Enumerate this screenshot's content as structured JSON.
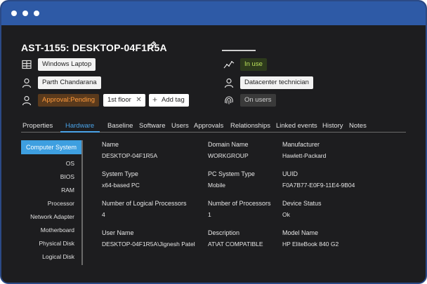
{
  "asset": {
    "title": "AST-1155: DESKTOP-04F1R5A"
  },
  "properties": {
    "type": "Windows Laptop",
    "user": "Parth Chandarana",
    "approval": "Approval:Pending",
    "tag": "1st floor",
    "add_tag": "Add tag",
    "state": "In use",
    "department": "Datacenter technician",
    "site": "On users"
  },
  "tabs": [
    "Properties",
    "Hardware",
    "Baseline",
    "Software",
    "Users",
    "Approvals",
    "Relationships",
    "Linked events",
    "History",
    "Notes"
  ],
  "active_tab": "Hardware",
  "sidebar": {
    "items": [
      "Computer System",
      "OS",
      "BIOS",
      "RAM",
      "Processor",
      "Network Adapter",
      "Motherboard",
      "Physical Disk",
      "Logical Disk"
    ]
  },
  "fields": [
    {
      "label": "Name",
      "value": "DESKTOP-04F1R5A"
    },
    {
      "label": "Domain Name",
      "value": "WORKGROUP"
    },
    {
      "label": "Manufacturer",
      "value": "Hawlett-Packard"
    },
    {
      "label": "System Type",
      "value": "x64-based PC"
    },
    {
      "label": "PC System Type",
      "value": "Mobile"
    },
    {
      "label": "UUID",
      "value": "F0A7B77-E0F9-11E4-9B04"
    },
    {
      "label": "Number of Logical Processors",
      "value": "4"
    },
    {
      "label": "Number of Processors",
      "value": "1"
    },
    {
      "label": "Device Status",
      "value": "Ok"
    },
    {
      "label": "User Name",
      "value": "DESKTOP-04F1R5A\\Jignesh Patel"
    },
    {
      "label": "Description",
      "value": "AT\\AT COMPATIBLE"
    },
    {
      "label": "Model Name",
      "value": "HP EliteBook 840 G2"
    }
  ],
  "colors": {
    "titlebar": "#2e5aa6",
    "background": "#1d1d1f",
    "accent": "#3e9fe0",
    "approval": "#ff9a3c",
    "in_use": "#b9e05a"
  },
  "icons": {
    "type": "windows-grid-icon",
    "user": "user-icon",
    "approval": "user-icon",
    "state": "activity-icon",
    "department": "user-icon",
    "site": "fingerprint-icon",
    "edit": "pencil-icon",
    "remove_tag": "close-icon",
    "add_tag": "plus-icon"
  }
}
